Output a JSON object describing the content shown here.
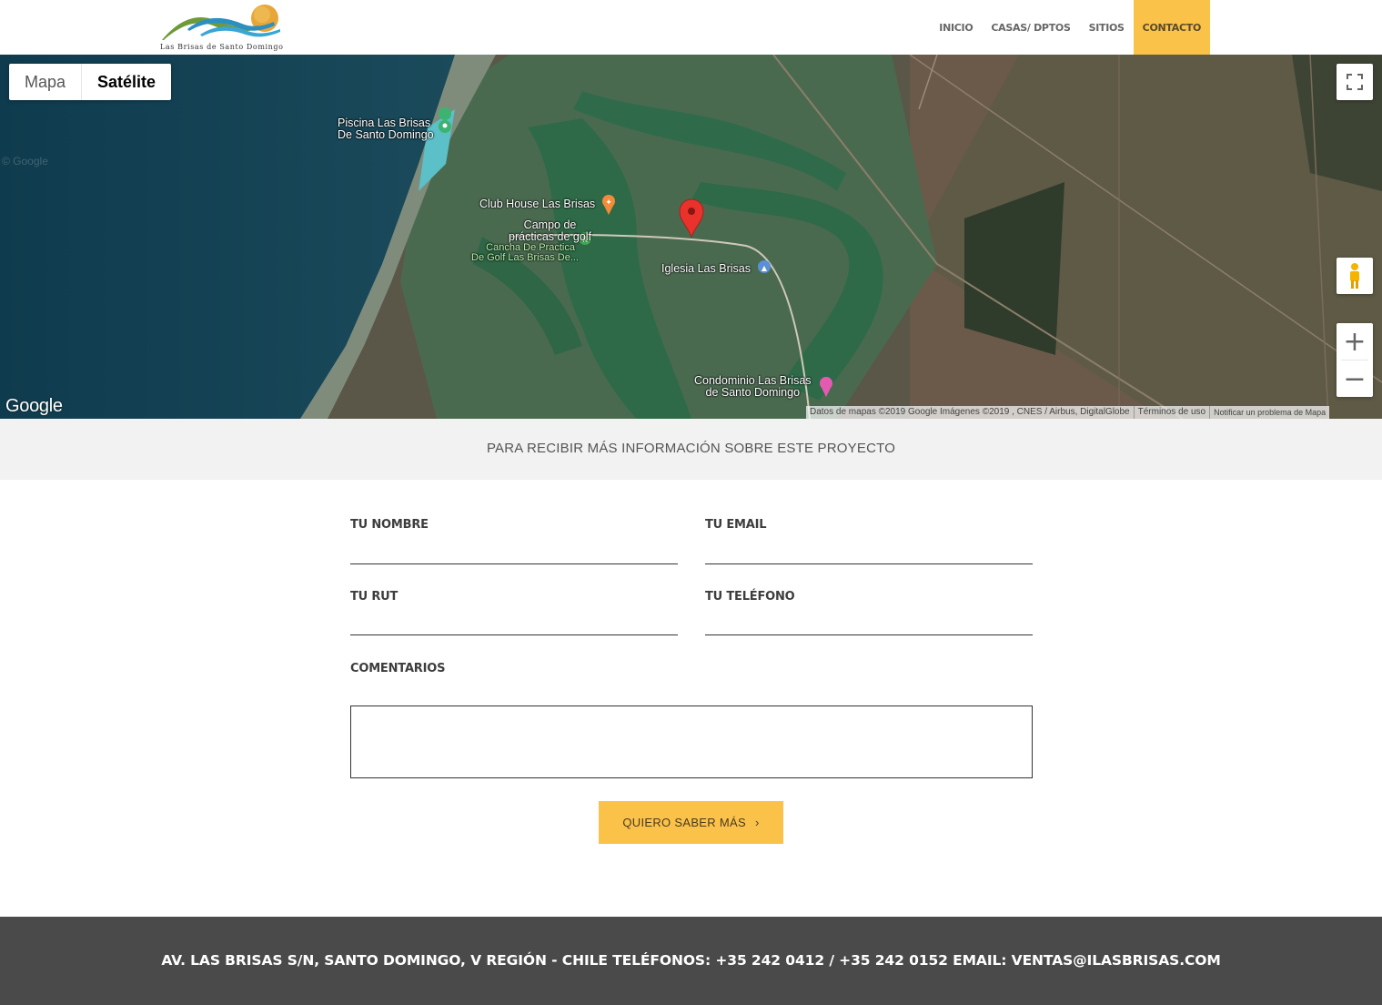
{
  "header": {
    "logo_text": "Las Brisas de Santo Domingo",
    "nav": [
      {
        "label": "INICIO",
        "active": false
      },
      {
        "label": "CASAS/ DPTOS",
        "active": false
      },
      {
        "label": "SITIOS",
        "active": false
      },
      {
        "label": "CONTACTO",
        "active": true
      }
    ],
    "accent_color": "#fbc24a"
  },
  "map": {
    "type_buttons": {
      "map": "Mapa",
      "satellite": "Satélite"
    },
    "selected_type": "Satélite",
    "places": {
      "piscina": "Piscina Las Brisas De Santo Domingo",
      "club_house": "Club House Las Brisas",
      "campo": "Campo de prácticas de golf",
      "cancha": "Cancha De Practica De Golf Las Brisas De...",
      "iglesia": "Iglesia Las Brisas",
      "condominio": "Condominio Las Brisas de Santo Domingo"
    },
    "place_lines": {
      "piscina_1": "Piscina Las Brisas",
      "piscina_2": "De Santo Domingo",
      "campo_1": "Campo de",
      "campo_2": "prácticas de golf",
      "cancha_1": "Cancha De Practica",
      "cancha_2": "De Golf Las Brisas De...",
      "condominio_1": "Condominio Las Brisas",
      "condominio_2": "de Santo Domingo"
    },
    "google_logo": "Google",
    "faint_watermark": "© Google",
    "attribution": {
      "data": "Datos de mapas ©2019 Google Imágenes ©2019 , CNES / Airbus, DigitalGlobe",
      "terms": "Términos de uso",
      "report": "Notificar un problema de Mapa"
    },
    "zoom_in": "+",
    "zoom_out": "−"
  },
  "band": {
    "text": "PARA RECIBIR MÁS INFORMACIÓN SOBRE ESTE PROYECTO"
  },
  "form": {
    "name_label": "TU NOMBRE",
    "email_label": "TU EMAIL",
    "rut_label": "TU RUT",
    "phone_label": "TU TELÉFONO",
    "comments_label": "COMENTARIOS",
    "submit_label": "QUIERO SABER MÁS",
    "submit_arrow": "›"
  },
  "footer": {
    "text": "AV. LAS BRISAS S/N, SANTO DOMINGO, V REGIÓN - CHILE TELÉFONOS: +35 242 0412 / +35 242 0152 EMAIL: VENTAS@ILASBRISAS.COM"
  }
}
